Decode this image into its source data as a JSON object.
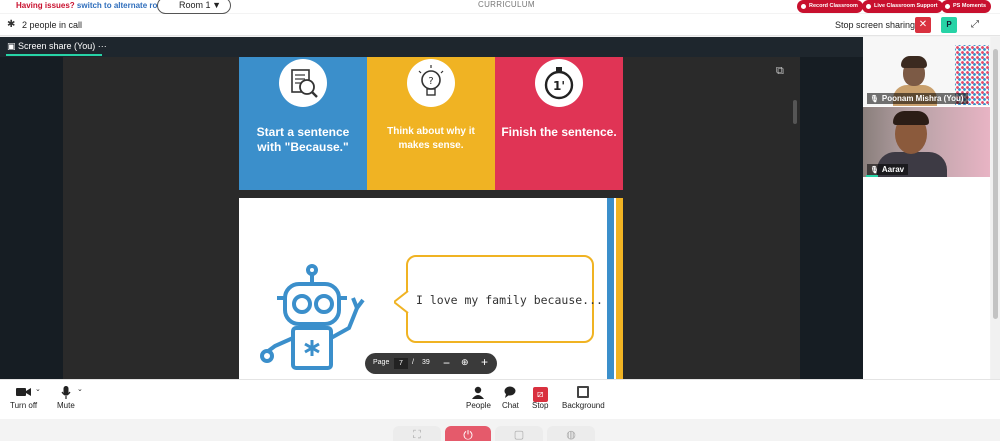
{
  "topbar": {
    "issues_question": "Having issues?",
    "issues_link": "switch to alternate room",
    "room_label": "Room 1",
    "center_title": "CURRICULUM",
    "pills": [
      "Record Classroom",
      "Live Classroom Support",
      "PS Moments"
    ]
  },
  "callbar": {
    "people_count": "2 people in call",
    "stop_sharing": "Stop screen sharing",
    "close_glyph": "✕",
    "avatar_letter": "P"
  },
  "stage": {
    "tab_label": "Screen share (You)",
    "tab_more": "···"
  },
  "slide": {
    "cards": [
      {
        "icon": "magnifier-document-icon",
        "caption": "Start a sentence with \"Because.\"",
        "color": "#3b8fcb"
      },
      {
        "icon": "lightbulb-question-icon",
        "caption": "Think about why it makes sense.",
        "color": "#f0b323"
      },
      {
        "icon": "stopwatch-icon",
        "caption": "Finish the sentence.",
        "color": "#e03455"
      }
    ],
    "bubble_text": "I love my family because...",
    "robot_icon": "robot-icon"
  },
  "pager": {
    "label": "Page",
    "current": "7",
    "separator": "/",
    "total": "39"
  },
  "participants": [
    {
      "name": "Poonam Mishra (You)"
    },
    {
      "name": "Aarav"
    }
  ],
  "controls": [
    {
      "label": "Turn off",
      "icon": "camera-icon"
    },
    {
      "label": "Mute",
      "icon": "mic-icon"
    },
    {
      "label": "People",
      "icon": "people-icon"
    },
    {
      "label": "Chat",
      "icon": "chat-icon"
    },
    {
      "label": "Stop",
      "icon": "stop-share-icon"
    },
    {
      "label": "Background",
      "icon": "background-icon"
    }
  ],
  "colors": {
    "accent": "#27d3a6",
    "danger": "#d9313f",
    "brand_red": "#c8102e",
    "link_blue": "#2f6ebc"
  }
}
